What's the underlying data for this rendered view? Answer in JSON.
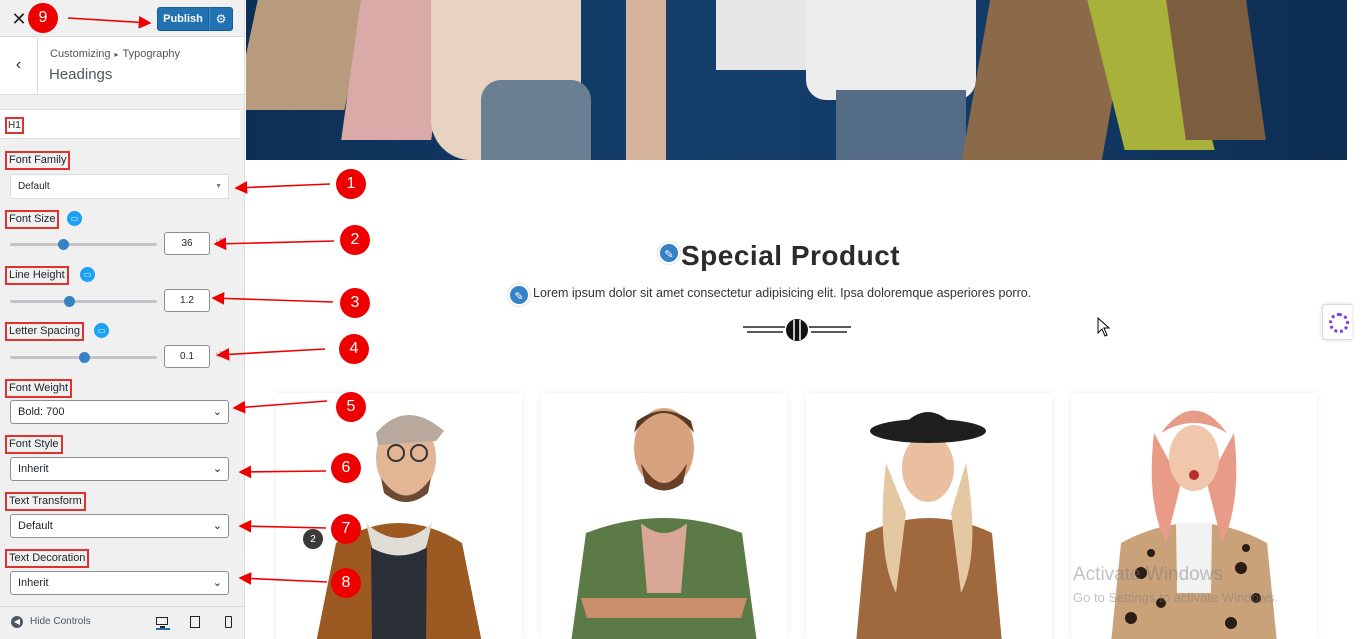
{
  "topbar": {
    "close_glyph": "✕",
    "publish_label": "Publish",
    "settings_glyph": "⚙"
  },
  "header": {
    "back_glyph": "‹",
    "breadcrumb_root": "Customizing",
    "breadcrumb_sep": "▸",
    "breadcrumb_leaf": "Typography",
    "title": "Headings"
  },
  "heading_tab": "H1",
  "controls": {
    "font_family": {
      "label": "Font Family",
      "value": "Default",
      "arrow": "▼"
    },
    "font_size": {
      "label": "Font Size",
      "value": "36",
      "slider_fraction": 0.36
    },
    "line_height": {
      "label": "Line Height",
      "value": "1.2",
      "slider_fraction": 0.4
    },
    "letter_spacing": {
      "label": "Letter Spacing",
      "value": "0.1",
      "slider_fraction": 0.5
    },
    "font_weight": {
      "label": "Font Weight",
      "value": "Bold: 700"
    },
    "font_style": {
      "label": "Font Style",
      "value": "Inherit"
    },
    "text_transform": {
      "label": "Text Transform",
      "value": "Default"
    },
    "text_decoration": {
      "label": "Text Decoration",
      "value": "Inherit"
    }
  },
  "chevron_glyph": "⌄",
  "footer": {
    "hide_controls_label": "Hide Controls",
    "hide_controls_glyph": "◀"
  },
  "markers": [
    "1",
    "2",
    "3",
    "4",
    "5",
    "6",
    "7",
    "8",
    "9"
  ],
  "preview": {
    "section_title": "Special Product",
    "section_desc": "Lorem ipsum dolor sit amet consectetur adipisicing elit. Ipsa doloremque asperiores porro.",
    "pencil_glyph": "✎",
    "card_badge": "2",
    "watermark_title": "Activate Windows",
    "watermark_sub": "Go to Settings to activate Windows."
  },
  "colors": {
    "accent": "#2271b1",
    "annotation_red": "#e00000",
    "responsive_icon": "#1da1f2",
    "hero_blue": "#0c2f55"
  }
}
